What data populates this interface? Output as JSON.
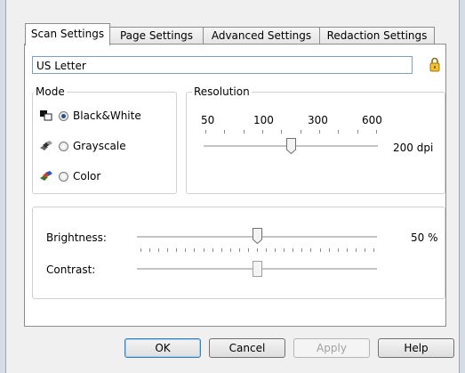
{
  "tabs": [
    {
      "label": "Scan Settings",
      "active": true
    },
    {
      "label": "Page Settings",
      "active": false
    },
    {
      "label": "Advanced Settings",
      "active": false
    },
    {
      "label": "Redaction Settings",
      "active": false
    }
  ],
  "preset": {
    "value": "US Letter",
    "lock_icon": "padlock-icon"
  },
  "mode": {
    "title": "Mode",
    "options": [
      {
        "label": "Black&White",
        "icon": "black-white-icon",
        "checked": true
      },
      {
        "label": "Grayscale",
        "icon": "grayscale-icon",
        "checked": false
      },
      {
        "label": "Color",
        "icon": "color-icon",
        "checked": false
      }
    ]
  },
  "resolution": {
    "title": "Resolution",
    "tick_labels": [
      "50",
      "100",
      "300",
      "600"
    ],
    "value_text": "200 dpi",
    "slider_fraction": 0.5
  },
  "brightness": {
    "label": "Brightness:",
    "value_text": "50 %",
    "slider_fraction": 0.5
  },
  "contrast": {
    "label": "Contrast:",
    "slider_fraction": 0.5
  },
  "buttons": {
    "ok": "OK",
    "cancel": "Cancel",
    "apply": "Apply",
    "help": "Help"
  },
  "colors": {
    "accent": "#3c7fb1",
    "selected_radio": "#2a4f8a"
  }
}
